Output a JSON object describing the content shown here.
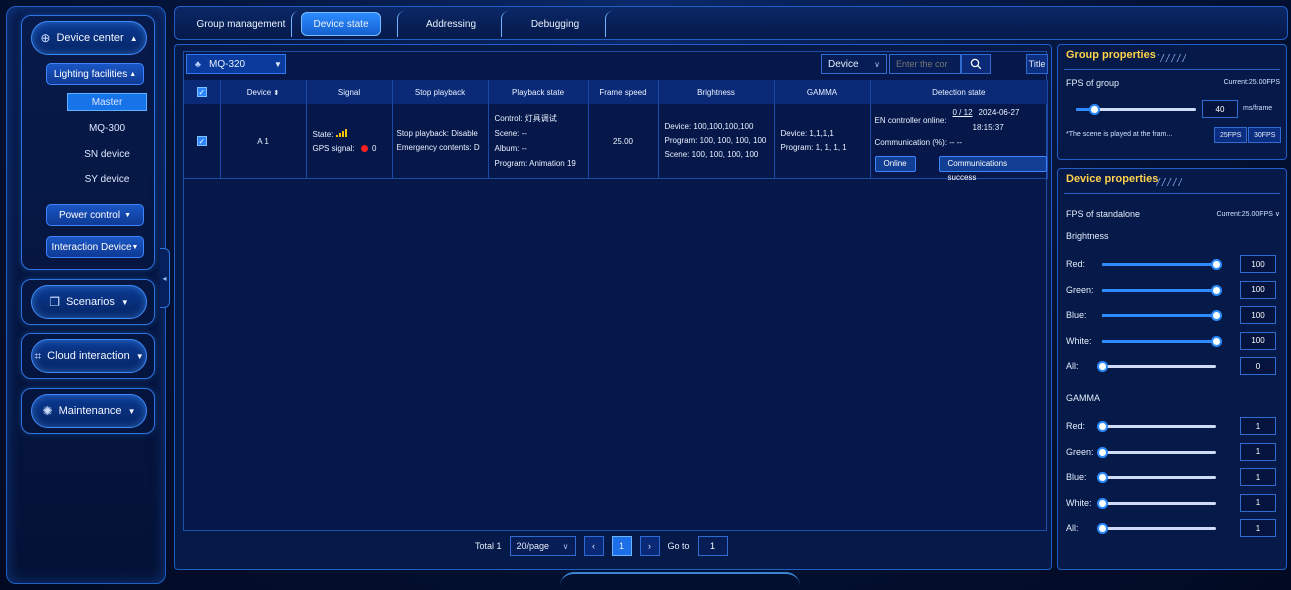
{
  "sidebar": {
    "device_center": "Device center",
    "lighting_facilities": "Lighting facilities",
    "leaves": [
      "Master",
      "MQ-300",
      "SN device",
      "SY device"
    ],
    "power_control": "Power control",
    "interaction_device": "Interaction Device",
    "scenarios": "Scenarios",
    "cloud_interaction": "Cloud interaction",
    "maintenance": "Maintenance"
  },
  "tabs": [
    "Group management",
    "Device state",
    "Addressing",
    "Debugging"
  ],
  "toolbar": {
    "device_model": "MQ-320",
    "filter": "Device",
    "search_placeholder": "Enter the cor",
    "title_button": "Title"
  },
  "table": {
    "headers": [
      "Device",
      "Signal",
      "Stop playback",
      "Playback state",
      "Frame speed",
      "Brightness",
      "GAMMA",
      "Detection state"
    ],
    "row": {
      "device": "A 1",
      "signal_state_label": "State: ",
      "signal_gps_label": "GPS signal: ",
      "signal_gps_value": "0",
      "stop_playback": "Stop playback: Disable",
      "emergency": "Emergency contents: D",
      "control": "Control: 灯具调试",
      "scene": "Scene: --",
      "album": "Album: --",
      "program": "Program: Animation 19",
      "frame_speed": "25.00",
      "brightness_device": "Device: 100,100,100,100",
      "brightness_program": "Program: 100, 100, 100, 100",
      "brightness_scene": "Scene: 100, 100, 100, 100",
      "gamma_device": "Device: 1,1,1,1",
      "gamma_program": "Program: 1, 1, 1, 1",
      "det_en_label": "EN controller online: ",
      "det_en_value": "0 / 12",
      "det_date": "2024-06-27",
      "det_time": "18:15:37",
      "det_comm": "Communication (%): -- --",
      "btn_online": "Online",
      "btn_comm": "Communications success"
    }
  },
  "pager": {
    "total": "Total 1",
    "page_size": "20/page",
    "current": "1",
    "goto_label": "Go to",
    "goto_value": "1"
  },
  "group_props": {
    "title": "Group properties",
    "fps_label": "FPS of group",
    "current": "Current:25.00FPS",
    "frame_value": "40",
    "frame_unit": "ms/frame",
    "note": "*The scene is played at the fram...",
    "btn_25": "25FPS",
    "btn_30": "30FPS",
    "frame_fraction": 0.15
  },
  "device_props": {
    "title": "Device properties",
    "fps_label": "FPS of standalone",
    "current": "Current:25.00FPS",
    "brightness_label": "Brightness",
    "gamma_label": "GAMMA",
    "brightness": [
      {
        "label": "Red:",
        "value": "100",
        "fraction": 1.0
      },
      {
        "label": "Green:",
        "value": "100",
        "fraction": 1.0
      },
      {
        "label": "Blue:",
        "value": "100",
        "fraction": 1.0
      },
      {
        "label": "White:",
        "value": "100",
        "fraction": 1.0
      },
      {
        "label": "All:",
        "value": "0",
        "fraction": 0.0
      }
    ],
    "gamma": [
      {
        "label": "Red:",
        "value": "1",
        "fraction": 0.0
      },
      {
        "label": "Green:",
        "value": "1",
        "fraction": 0.0
      },
      {
        "label": "Blue:",
        "value": "1",
        "fraction": 0.0
      },
      {
        "label": "White:",
        "value": "1",
        "fraction": 0.0
      },
      {
        "label": "All:",
        "value": "1",
        "fraction": 0.0
      }
    ]
  },
  "colors": {
    "accent": "#2c8cff",
    "title": "#ffd24a",
    "signal": "#f7c300",
    "gps_dot": "#ff2020"
  }
}
